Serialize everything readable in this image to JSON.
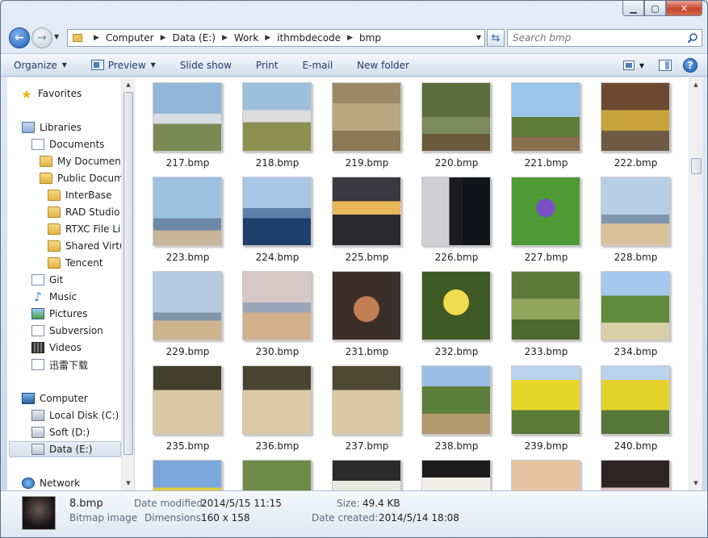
{
  "address": {
    "crumbs": [
      "Computer",
      "Data (E:)",
      "Work",
      "ithmbdecode",
      "bmp"
    ]
  },
  "search": {
    "placeholder": "Search bmp"
  },
  "toolbar": {
    "organize": "Organize",
    "preview": "Preview",
    "slideshow": "Slide show",
    "print": "Print",
    "email": "E-mail",
    "newfolder": "New folder"
  },
  "nav": {
    "favorites": "Favorites",
    "libraries": "Libraries",
    "documents": "Documents",
    "my_documents": "My Documents",
    "public_documents": "Public Docume",
    "interbase": "InterBase",
    "rad_studio": "RAD Studio",
    "rtxc": "RTXC File List",
    "shared_virtual": "Shared Virtua",
    "tencent": "Tencent",
    "git": "Git",
    "music": "Music",
    "pictures": "Pictures",
    "subversion": "Subversion",
    "videos": "Videos",
    "xunlei": "迅雷下载",
    "computer": "Computer",
    "local_c": "Local Disk (C:)",
    "soft_d": "Soft (D:)",
    "data_e": "Data (E:)",
    "network": "Network"
  },
  "files": [
    {
      "name": "217.bmp",
      "bg": "linear-gradient(#8fb6d6 0 45%, #d8dde3 45% 60%, #7b8a54 60%)"
    },
    {
      "name": "218.bmp",
      "bg": "linear-gradient(#9ec0dc 0 40%, #dcdcdc 40% 58%, #8b8f50 58%)"
    },
    {
      "name": "219.bmp",
      "bg": "linear-gradient(#9c8a66 0 30%, #b9a57e 30% 70%, #8b7a55 70%)"
    },
    {
      "name": "220.bmp",
      "bg": "linear-gradient(#5a6e3c 0 50%, #7c8a5c 50% 75%, #6a5a3c 75%)"
    },
    {
      "name": "221.bmp",
      "bg": "linear-gradient(#9cc6ec 0 50%, #5e7b3a 50% 80%, #8c6e4e 80%)"
    },
    {
      "name": "222.bmp",
      "bg": "linear-gradient(#6c4a32 0 40%, #c8a33c 40% 70%, #6e5c44 70%)"
    },
    {
      "name": "223.bmp",
      "bg": "linear-gradient(#9ec1e1 0 60%, #6c88a6 60% 78%, #c7b59a 78%)"
    },
    {
      "name": "224.bmp",
      "bg": "linear-gradient(#a9c6e6 0 45%, #5c80a8 45% 60%, #1f3f6c 60%)"
    },
    {
      "name": "225.bmp",
      "bg": "linear-gradient(#3a3a40 0 35%, #e8b75a 35% 55%, #2a2a2e 55%)"
    },
    {
      "name": "226.bmp",
      "bg": "linear-gradient(90deg, #cfcfd4 0 40%, #1c1c20 40% 60%, #0f1418 60%)"
    },
    {
      "name": "227.bmp",
      "bg": "radial-gradient(circle at 50% 45%, #7a4fc6 0 18%, #4e9a34 19% 100%)"
    },
    {
      "name": "228.bmp",
      "bg": "linear-gradient(#b6cfe6 0 55%, #7d95ad 55% 68%, #d8c09a 68%)"
    },
    {
      "name": "229.bmp",
      "bg": "linear-gradient(#b4cbe2 0 60%, #7f95a8 60% 72%, #cdb48f 72%)"
    },
    {
      "name": "230.bmp",
      "bg": "linear-gradient(#d6c8c6 0 45%, #9aa6b6 45% 60%, #d3b08c 60%)"
    },
    {
      "name": "231.bmp",
      "bg": "radial-gradient(circle at 50% 55%, #c27f54 0 25%, #3c2f2a 26% 100%)"
    },
    {
      "name": "232.bmp",
      "bg": "radial-gradient(circle at 50% 45%, #f0dc4c 0 25%, #3f5a24 26% 100%)"
    },
    {
      "name": "233.bmp",
      "bg": "linear-gradient(#5e7a3a 0 40%, #8fa65a 40% 70%, #4c6a30 70%)"
    },
    {
      "name": "234.bmp",
      "bg": "linear-gradient(#a6c8ee 0 35%, #5f8a3c 35% 75%, #d9cfa6 75%)"
    },
    {
      "name": "235.bmp",
      "bg": "linear-gradient(#433f2e 0 35%, #d9c8a4 35% 100%)"
    },
    {
      "name": "236.bmp",
      "bg": "linear-gradient(#4a4532 0 35%, #dccaa6 35% 100%)"
    },
    {
      "name": "237.bmp",
      "bg": "linear-gradient(#4d4733 0 35%, #dbc9a4 35% 100%)"
    },
    {
      "name": "238.bmp",
      "bg": "linear-gradient(#9bc0e6 0 30%, #5f7f3c 30% 70%, #b49a70 70%)"
    },
    {
      "name": "239.bmp",
      "bg": "linear-gradient(#b9d2ee 0 20%, #e6d62a 20% 65%, #5a7a36 65%)"
    },
    {
      "name": "240.bmp",
      "bg": "linear-gradient(#b9d2ee 0 20%, #e3d22c 20% 65%, #56763a 65%)"
    },
    {
      "name": "",
      "bg": "linear-gradient(#7aa6dc 0 40%, #e0cc3c 40% 100%)"
    },
    {
      "name": "",
      "bg": "linear-gradient(#6e8a48 0 100%)"
    },
    {
      "name": "",
      "bg": "linear-gradient(#2a2a2a 0 30%, #e8e8e2 30% 100%)"
    },
    {
      "name": "",
      "bg": "linear-gradient(#1b1b1b 0 25%, #f2efe8 25% 100%)"
    },
    {
      "name": "",
      "bg": "linear-gradient(#e6c4a2 0 60%, #1c1c1c 60%)"
    },
    {
      "name": "",
      "bg": "linear-gradient(#2e2426 0 40%, #e2c0c6 40% 100%)"
    }
  ],
  "details": {
    "name": "8.bmp",
    "type": "Bitmap image",
    "date_modified_label": "Date modified:",
    "date_modified": "2014/5/15 11:15",
    "dimensions_label": "Dimensions:",
    "dimensions": "160 x 158",
    "size_label": "Size:",
    "size": "49.4 KB",
    "date_created_label": "Date created:",
    "date_created": "2014/5/14 18:08"
  }
}
